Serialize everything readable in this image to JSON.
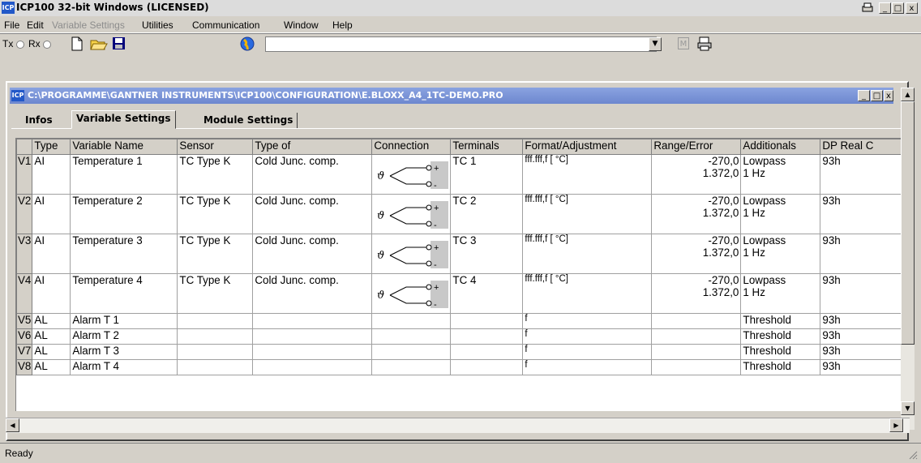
{
  "app": {
    "icon_text": "ICP",
    "title": "ICP100 32-bit Windows  (LICENSED)",
    "window_buttons": [
      "_",
      "□",
      "x"
    ]
  },
  "menu": [
    {
      "label": "File",
      "enabled": true
    },
    {
      "label": "Edit",
      "enabled": true
    },
    {
      "label": "Variable Settings",
      "enabled": false
    },
    {
      "label": "Utilities",
      "enabled": true
    },
    {
      "label": "Communication",
      "enabled": true
    },
    {
      "label": "Window",
      "enabled": true
    },
    {
      "label": "Help",
      "enabled": true
    }
  ],
  "toolbar": {
    "tx_label": "Tx",
    "rx_label": "Rx",
    "combo_value": "",
    "icons": [
      "new-file-icon",
      "open-folder-icon",
      "save-icon",
      "globe-icon",
      "m-icon",
      "printer-icon"
    ]
  },
  "child": {
    "icon_text": "ICP",
    "title": "C:\\PROGRAMME\\GANTNER INSTRUMENTS\\ICP100\\CONFIGURATION\\E.BLOXX_A4_1TC-DEMO.PRO",
    "tabs": [
      {
        "label": "Infos",
        "active": false
      },
      {
        "label": "Variable Settings",
        "active": true
      },
      {
        "label": "Module Settings",
        "active": false
      }
    ]
  },
  "grid": {
    "columns": [
      "",
      "Type",
      "Variable Name",
      "Sensor",
      "Type of",
      "Connection",
      "Terminals",
      "Format/Adjustment",
      "Range/Error",
      "Additionals",
      "DP Real C"
    ],
    "rows": [
      {
        "id": "V1",
        "type": "AI",
        "name": "Temperature 1",
        "sensor": "TC Type K",
        "type_of": "Cold Junc. comp.",
        "terminals": "TC 1",
        "format": "fff.fff,f [ °C]",
        "range1": "-270,0",
        "range2": "1.372,0",
        "add1": "Lowpass",
        "add2": "1 Hz",
        "dp": "93h",
        "connection": true
      },
      {
        "id": "V2",
        "type": "AI",
        "name": "Temperature 2",
        "sensor": "TC Type K",
        "type_of": "Cold Junc. comp.",
        "terminals": "TC 2",
        "format": "fff.fff,f [ °C]",
        "range1": "-270,0",
        "range2": "1.372,0",
        "add1": "Lowpass",
        "add2": "1 Hz",
        "dp": "93h",
        "connection": true
      },
      {
        "id": "V3",
        "type": "AI",
        "name": "Temperature 3",
        "sensor": "TC Type K",
        "type_of": "Cold Junc. comp.",
        "terminals": "TC 3",
        "format": "fff.fff,f [ °C]",
        "range1": "-270,0",
        "range2": "1.372,0",
        "add1": "Lowpass",
        "add2": "1 Hz",
        "dp": "93h",
        "connection": true
      },
      {
        "id": "V4",
        "type": "AI",
        "name": "Temperature 4",
        "sensor": "TC Type K",
        "type_of": "Cold Junc. comp.",
        "terminals": "TC 4",
        "format": "fff.fff,f [ °C]",
        "range1": "-270,0",
        "range2": "1.372,0",
        "add1": "Lowpass",
        "add2": "1 Hz",
        "dp": "93h",
        "connection": true
      },
      {
        "id": "V5",
        "type": "AL",
        "name": "Alarm T 1",
        "sensor": "",
        "type_of": "",
        "terminals": "",
        "format": "f",
        "range1": "",
        "range2": "",
        "add1": "Threshold",
        "add2": "",
        "dp": "93h",
        "connection": false
      },
      {
        "id": "V6",
        "type": "AL",
        "name": "Alarm T 2",
        "sensor": "",
        "type_of": "",
        "terminals": "",
        "format": "f",
        "range1": "",
        "range2": "",
        "add1": "Threshold",
        "add2": "",
        "dp": "93h",
        "connection": false
      },
      {
        "id": "V7",
        "type": "AL",
        "name": "Alarm T 3",
        "sensor": "",
        "type_of": "",
        "terminals": "",
        "format": "f",
        "range1": "",
        "range2": "",
        "add1": "Threshold",
        "add2": "",
        "dp": "93h",
        "connection": false
      },
      {
        "id": "V8",
        "type": "AL",
        "name": "Alarm T 4",
        "sensor": "",
        "type_of": "",
        "terminals": "",
        "format": "f",
        "range1": "",
        "range2": "",
        "add1": "Threshold",
        "add2": "",
        "dp": "93h",
        "connection": false
      }
    ]
  },
  "connection_symbol": {
    "sensor_glyph": "ϑ",
    "plus": "+",
    "minus": "-"
  },
  "status": {
    "text": "Ready"
  }
}
